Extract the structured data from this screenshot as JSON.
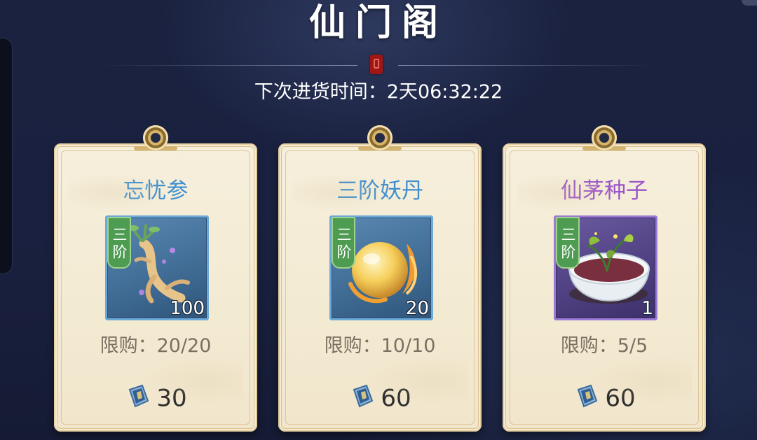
{
  "header": {
    "title": "仙门阁",
    "restock_label": "下次进货时间：",
    "restock_time": "2天06:32:22"
  },
  "cards": [
    {
      "name": "忘忧参",
      "name_color": "#3f8fd0",
      "tier": "三阶",
      "quantity": "100",
      "item_icon": "ginseng-root-icon",
      "limit_label": "限购：",
      "limit_value": "20/20",
      "price": "30",
      "currency_icon": "jade-token-icon"
    },
    {
      "name": "三阶妖丹",
      "name_color": "#3f8fd0",
      "tier": "三阶",
      "quantity": "20",
      "item_icon": "golden-orb-icon",
      "limit_label": "限购：",
      "limit_value": "10/10",
      "price": "60",
      "currency_icon": "jade-token-icon"
    },
    {
      "name": "仙茅种子",
      "name_color": "#9b55c8",
      "tier": "三阶",
      "quantity": "1",
      "item_icon": "seed-bowl-icon",
      "limit_label": "限购：",
      "limit_value": "5/5",
      "price": "60",
      "currency_icon": "jade-token-icon"
    }
  ],
  "colors": {
    "background": "#1a2140",
    "card_bg": "#f4ecd6",
    "tier_tag": "#4e9b52",
    "blue_frame": "#4f7ea6",
    "purple_frame": "#5a4a90"
  }
}
